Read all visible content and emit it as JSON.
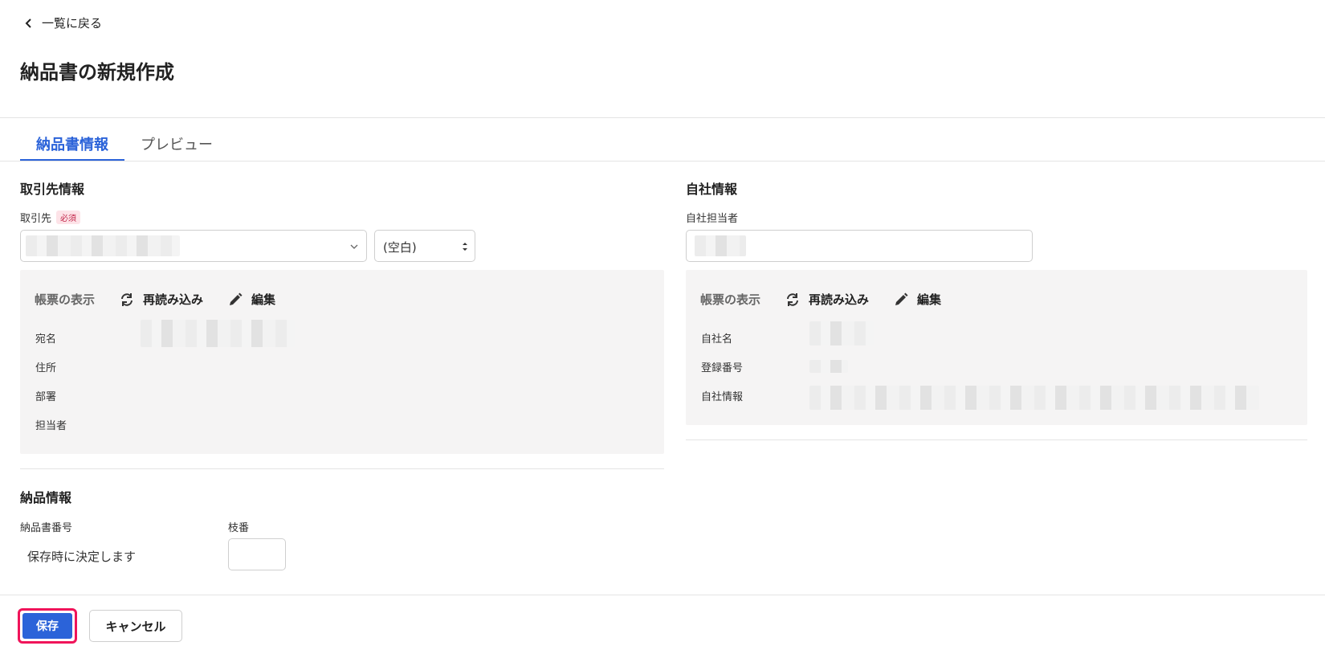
{
  "header": {
    "back_label": "一覧に戻る",
    "title": "納品書の新規作成"
  },
  "tabs": [
    {
      "label": "納品書情報",
      "active": true
    },
    {
      "label": "プレビュー",
      "active": false
    }
  ],
  "client": {
    "section_title": "取引先情報",
    "field_label": "取引先",
    "required_badge": "必須",
    "honorific_value": "(空白)",
    "panel": {
      "display_label": "帳票の表示",
      "reload_label": "再読み込み",
      "edit_label": "編集",
      "rows": [
        "宛名",
        "住所",
        "部署",
        "担当者"
      ]
    }
  },
  "company": {
    "section_title": "自社情報",
    "field_label": "自社担当者",
    "panel": {
      "display_label": "帳票の表示",
      "reload_label": "再読み込み",
      "edit_label": "編集",
      "rows": [
        "自社名",
        "登録番号",
        "自社情報"
      ]
    }
  },
  "delivery": {
    "section_title": "納品情報",
    "number_label": "納品書番号",
    "number_value": "保存時に決定します",
    "branch_label": "枝番"
  },
  "footer": {
    "save_label": "保存",
    "cancel_label": "キャンセル"
  },
  "colors": {
    "accent": "#2b63d9",
    "highlight": "#f0145a",
    "panel_bg": "#f5f4f4"
  }
}
